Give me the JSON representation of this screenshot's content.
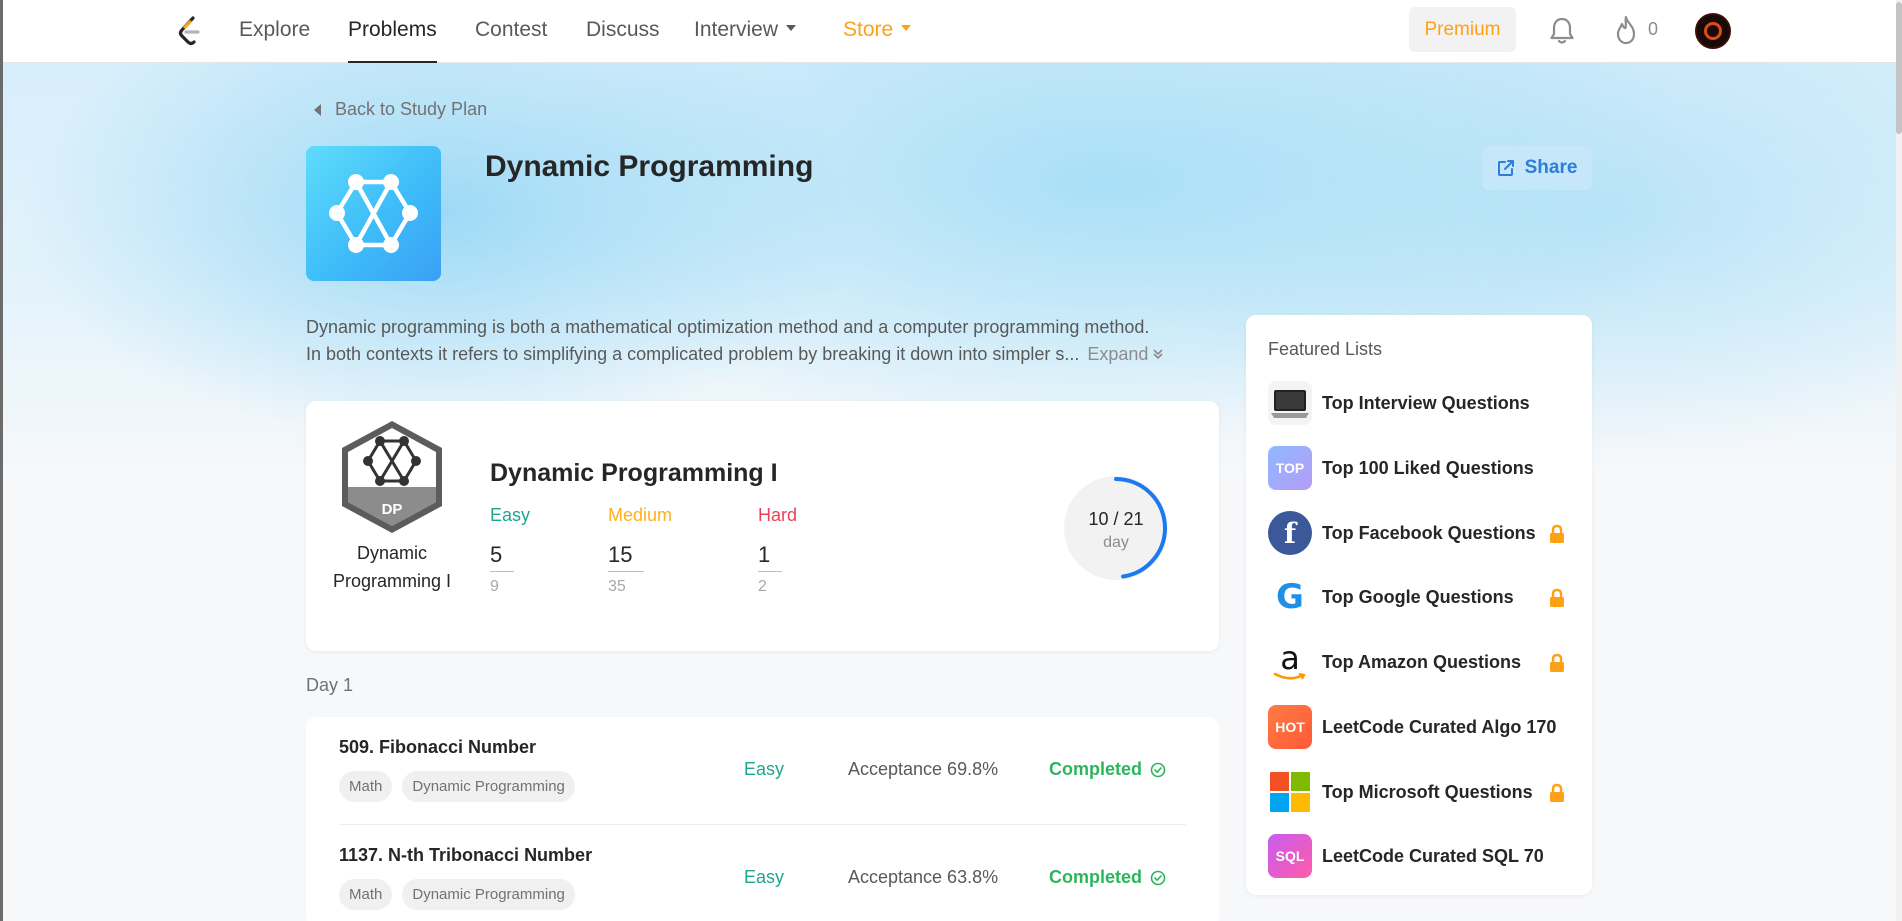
{
  "nav": {
    "items": [
      "Explore",
      "Problems",
      "Contest",
      "Discuss",
      "Interview",
      "Store"
    ],
    "premium_label": "Premium",
    "streak_count": "0"
  },
  "back_label": "Back to Study Plan",
  "plan": {
    "title": "Dynamic Programming",
    "share_label": "Share",
    "description_line1": "Dynamic programming is both a mathematical optimization method and a computer programming method.",
    "description_line2": "In both contexts it refers to simplifying a complicated problem by breaking it down into simpler s...",
    "expand_label": "Expand"
  },
  "progress": {
    "badge_text": "DP",
    "badge_caption": "Dynamic Programming I",
    "title": "Dynamic Programming I",
    "easy": {
      "label": "Easy",
      "done": "5",
      "total": "9"
    },
    "medium": {
      "label": "Medium",
      "done": "15",
      "total": "35"
    },
    "hard": {
      "label": "Hard",
      "done": "1",
      "total": "2"
    },
    "day_fraction": "10 / 21",
    "day_unit": "day",
    "day_progress": 0.476
  },
  "day_label": "Day 1",
  "questions": [
    {
      "title": "509. Fibonacci Number",
      "tags": [
        "Math",
        "Dynamic Programming"
      ],
      "difficulty": "Easy",
      "acceptance": "Acceptance 69.8%",
      "status": "Completed"
    },
    {
      "title": "1137. N-th Tribonacci Number",
      "tags": [
        "Math",
        "Dynamic Programming"
      ],
      "difficulty": "Easy",
      "acceptance": "Acceptance 63.8%",
      "status": "Completed"
    }
  ],
  "featured": {
    "title": "Featured Lists",
    "items": [
      {
        "label": "Top Interview Questions",
        "icon": "laptop-icon",
        "locked": false
      },
      {
        "label": "Top 100 Liked Questions",
        "icon": "top-icon",
        "icon_text": "TOP",
        "locked": false
      },
      {
        "label": "Top Facebook Questions",
        "icon": "facebook-icon",
        "icon_text": "f",
        "locked": true
      },
      {
        "label": "Top Google Questions",
        "icon": "google-icon",
        "icon_text": "G",
        "locked": true
      },
      {
        "label": "Top Amazon Questions",
        "icon": "amazon-icon",
        "icon_text": "a",
        "locked": true
      },
      {
        "label": "LeetCode Curated Algo 170",
        "icon": "hot-icon",
        "icon_text": "HOT",
        "locked": false
      },
      {
        "label": "Top Microsoft Questions",
        "icon": "microsoft-icon",
        "locked": true
      },
      {
        "label": "LeetCode Curated SQL 70",
        "icon": "sql-icon",
        "icon_text": "SQL",
        "locked": false
      }
    ]
  },
  "colors": {
    "accent_orange": "#ffa116",
    "easy": "#1fa58d",
    "medium": "#ffb01e",
    "hard": "#e9415a",
    "completed": "#2db55d",
    "ring": "#1a7af0"
  }
}
